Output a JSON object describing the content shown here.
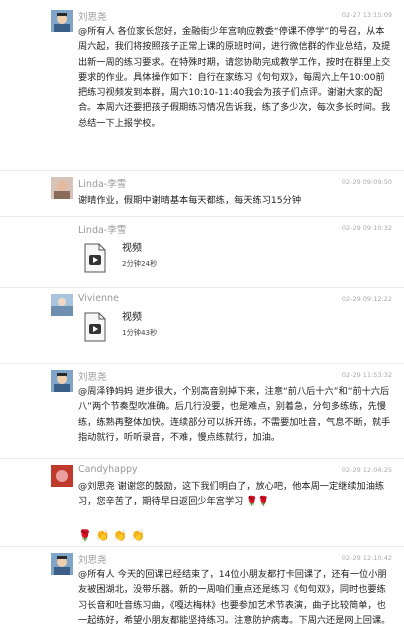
{
  "messages": [
    {
      "sender": "刘思尧",
      "time": "02-27 13:15:09",
      "text": "@所有人 各位家长您好，金融街少年宫响应教委“停课不停学”的号召，从本周六起，我们将按照孩子正常上课的原班时间，进行微信群的作业总结，及提出新一周的练习要求。在特殊时期，请您协助完成教学工作，按时在群里上交要求的作业。具体操作如下：自行在家练习《句句双》，每周六上午10:00前把练习视频发到本群，周六10:10-11:40我会为孩子们点评。谢谢大家的配合。本周六还要把孩子假期练习情况告诉我，练了多少次，每次多长时间。我总结一下上报学校。"
    },
    {
      "sender": "Linda-李雪",
      "time": "02-29 09:09:50",
      "text": "谢晴作业，假期中谢晴基本每天都练，每天练习15分钟"
    },
    {
      "sender": "Linda-李雪",
      "time": "02-29 09:10:32",
      "file": {
        "name": "视频",
        "meta": "2分钟24秒"
      }
    },
    {
      "sender": "Vivienne",
      "time": "02-29 09:12:22",
      "file": {
        "name": "视频",
        "meta": "1分钟43秒"
      }
    },
    {
      "sender": "刘思尧",
      "time": "02-29 11:53:32",
      "text": "@周泽铮妈妈 进步很大，个别高音别掉下来，注意“前八后十六”和“前十六后八”两个节奏型吹准确。后几行没要，也是难点，别着急，分句多练练，先慢练，练熟再整体加快。连续部分可以拆开练，不需要加吐音，气息不断，就手指动就行，听听录音，不难，慢点练就行，加油。"
    },
    {
      "sender": "Candyhappy",
      "time": "02-29 12:04:25",
      "text": "@刘思尧 谢谢您的鼓励，这下我们明白了，放心吧，他本周一定继续加油练习，您辛苦了，期待早日返回少年宫学习",
      "text_emoji": "🌹🌹",
      "emoji_line": "🌹👏👏👏"
    },
    {
      "sender": "刘思尧",
      "time": "02-29 12:10:42",
      "text": "@所有人 今天的回课已经结束了，14位小朋友都打卡回课了，还有一位小朋友被困湖北，没带乐器。新的一周咱们重点还是练习《句句双》，同时也要练习长音和吐音练习曲，《嘎达梅林》也要参加艺术节表演，曲子比较简单，也一起练好，希望小朋友都能坚持练习。注意防护病毒。下周六还是网上回课。"
    }
  ],
  "colors": {
    "name": "#999999",
    "time": "#aaaaaa",
    "text": "#222222",
    "separator": "#ececec"
  }
}
